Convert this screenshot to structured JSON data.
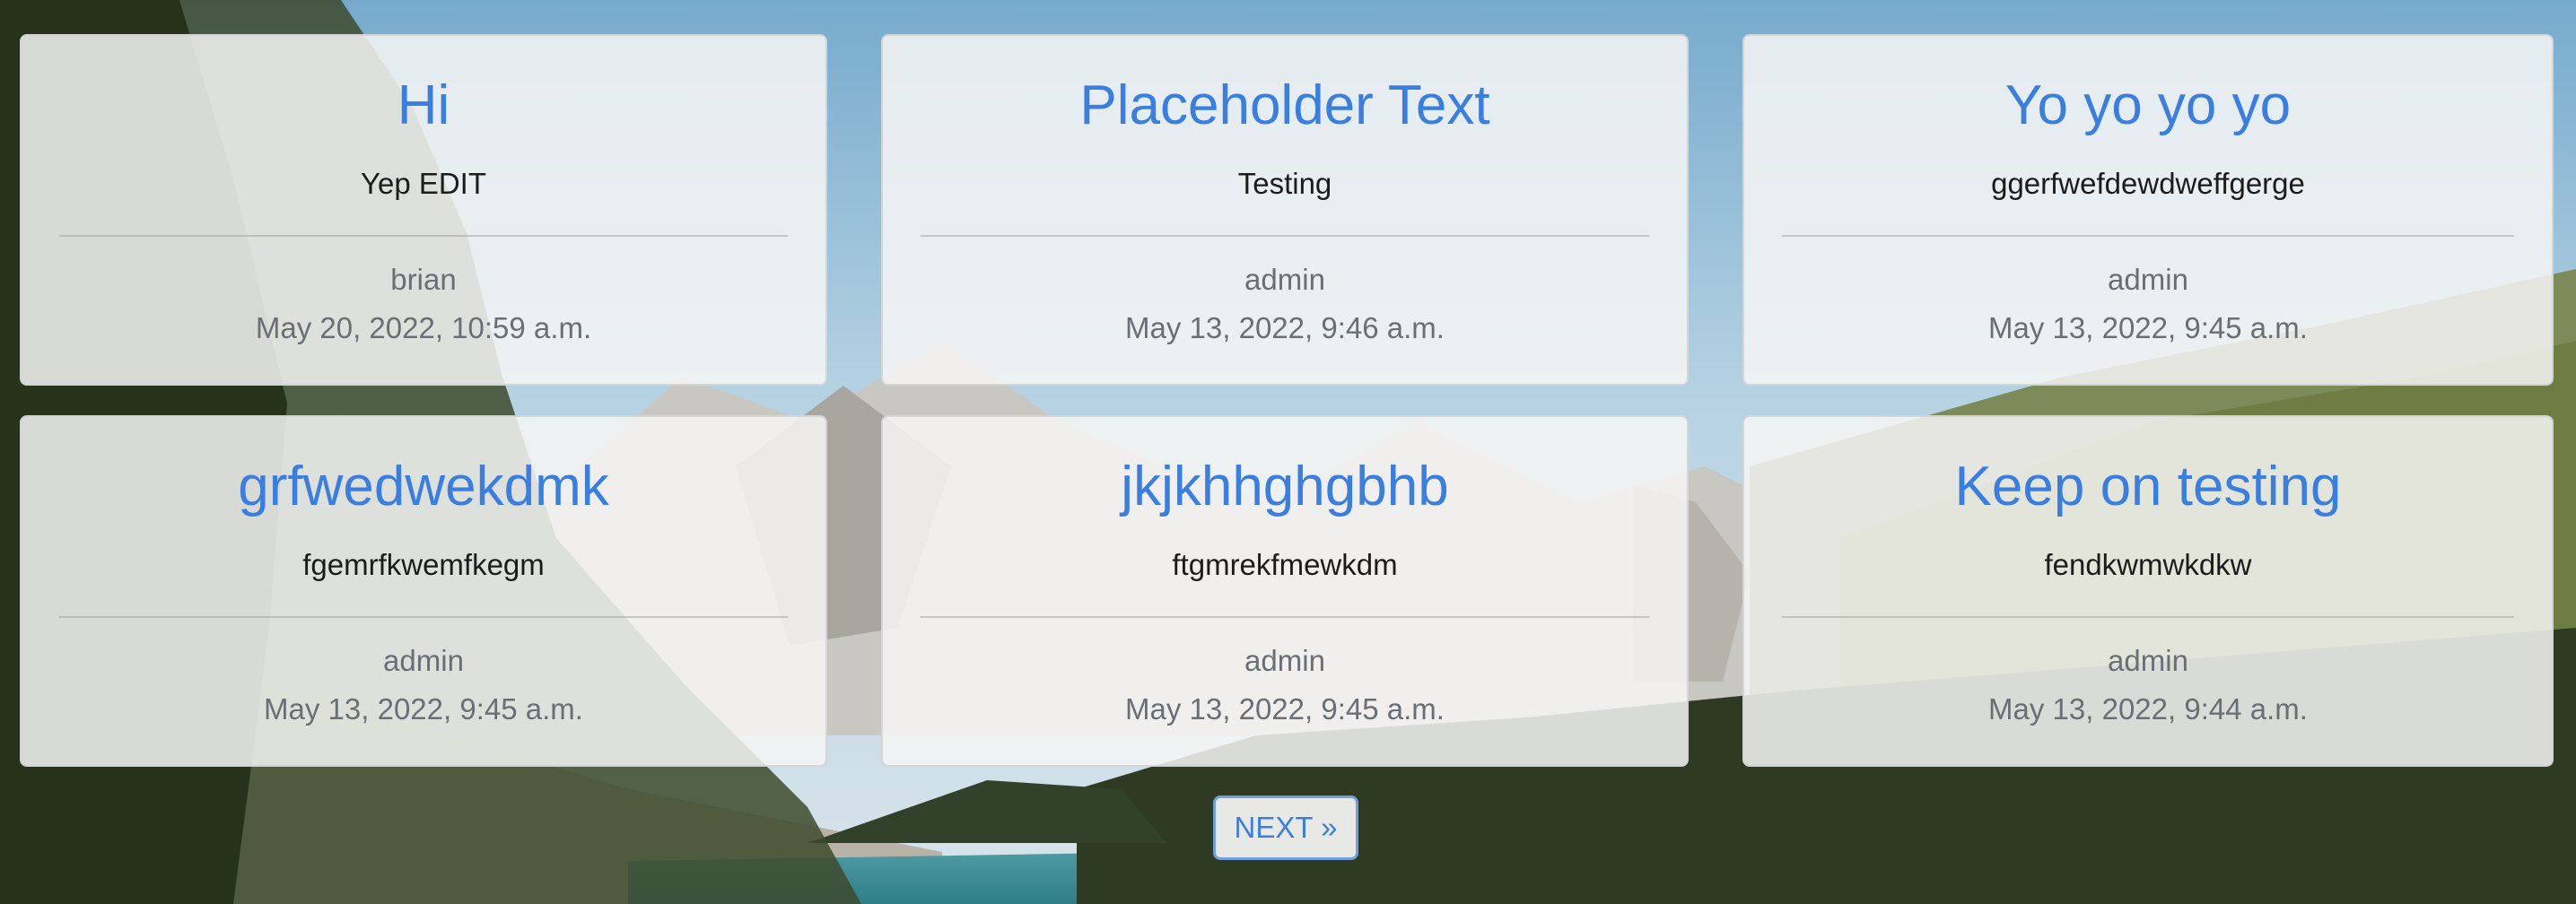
{
  "posts": [
    {
      "title": "Hi",
      "body": "Yep EDIT",
      "author": "brian",
      "date": "May 20, 2022, 10:59 a.m."
    },
    {
      "title": "Placeholder Text",
      "body": "Testing",
      "author": "admin",
      "date": "May 13, 2022, 9:46 a.m."
    },
    {
      "title": "Yo yo yo yo",
      "body": "ggerfwefdewdweffgerge",
      "author": "admin",
      "date": "May 13, 2022, 9:45 a.m."
    },
    {
      "title": "grfwedwekdmk",
      "body": "fgemrfkwemfkegm",
      "author": "admin",
      "date": "May 13, 2022, 9:45 a.m."
    },
    {
      "title": "jkjkhhghgbhb",
      "body": "ftgmrekfmewkdm",
      "author": "admin",
      "date": "May 13, 2022, 9:45 a.m."
    },
    {
      "title": "Keep on testing",
      "body": "fendkwmwkdkw",
      "author": "admin",
      "date": "May 13, 2022, 9:44 a.m."
    }
  ],
  "pagination": {
    "next_label": "NEXT »"
  },
  "colors": {
    "link": "#3a7ee0",
    "muted": "#6a6f75",
    "card_bg": "#f6f6f4"
  }
}
